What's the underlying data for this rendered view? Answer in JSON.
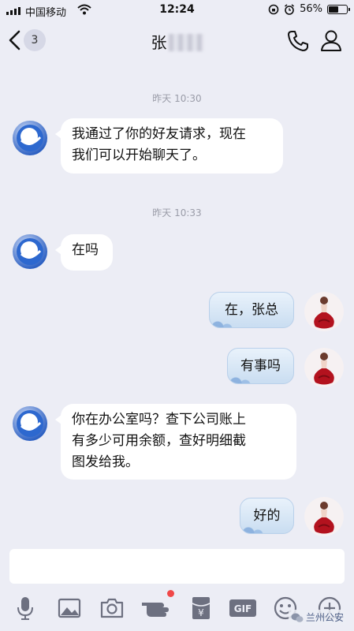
{
  "status_bar": {
    "carrier": "中国移动",
    "time": "12:24",
    "battery": "56%",
    "battery_level": 0.56
  },
  "header": {
    "unread_count": "3",
    "contact_name": "张",
    "icons": [
      "back-arrow-icon",
      "phone-icon",
      "person-icon"
    ]
  },
  "messages": [
    {
      "type": "timestamp",
      "text": "昨天 10:30"
    },
    {
      "type": "received",
      "lines": [
        "我通过了你的好友请求，现在",
        "我们可以开始聊天了。"
      ]
    },
    {
      "type": "timestamp",
      "text": "昨天 10:33"
    },
    {
      "type": "received",
      "lines": [
        "在吗"
      ]
    },
    {
      "type": "sent",
      "lines": [
        "在，张总"
      ]
    },
    {
      "type": "sent",
      "lines": [
        "有事吗"
      ]
    },
    {
      "type": "received",
      "lines": [
        "你在办公室吗？查下公司账上",
        "有多少可用余额，查好明细截",
        "图发给我。"
      ]
    },
    {
      "type": "sent",
      "lines": [
        "好的"
      ]
    }
  ],
  "input": {
    "value": ""
  },
  "toolbar": {
    "icons": [
      "microphone-icon",
      "image-icon",
      "camera-icon",
      "poke-icon",
      "red-packet-icon",
      "gif-icon",
      "emoji-icon",
      "plus-icon"
    ],
    "red_packet_label": "¥",
    "gif_label": "GIF"
  },
  "watermark": "兰州公安",
  "colors": {
    "background": "#ecedf5",
    "received_bubble": "#ffffff",
    "sent_bubble": "#d6e6f6",
    "notification_dot": "#f04848"
  }
}
